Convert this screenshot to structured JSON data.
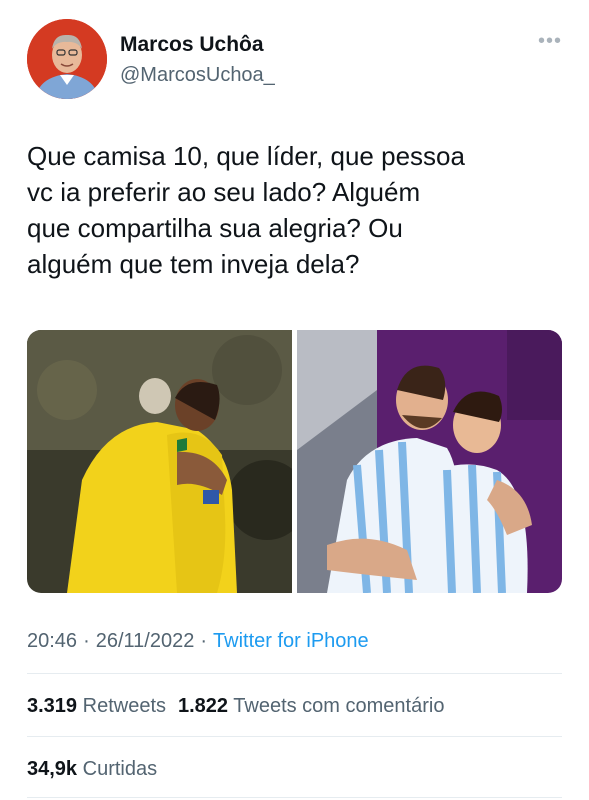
{
  "author": {
    "name": "Marcos Uchôa",
    "handle": "@MarcosUchoa_"
  },
  "tweet": {
    "lines": [
      "Que camisa 10, que líder, que pessoa",
      "vc ia preferir ao seu lado? Alguém",
      "que compartilha sua alegria? Ou",
      "alguém que tem inveja dela?"
    ],
    "time": "20:46",
    "date": "26/11/2022",
    "separator": "·",
    "source": "Twitter for iPhone"
  },
  "stats": {
    "retweets_count": "3.319",
    "retweets_label": "Retweets",
    "quotes_count": "1.822",
    "quotes_label": "Tweets com comentário",
    "likes_count": "34,9k",
    "likes_label": "Curtidas"
  },
  "icons": {
    "more": "more-options-icon"
  },
  "colors": {
    "link": "#1d9bf0",
    "secondary_text": "#536471",
    "brazil_yellow": "#f2d21b",
    "argentina_purple": "#5a1f6e"
  }
}
